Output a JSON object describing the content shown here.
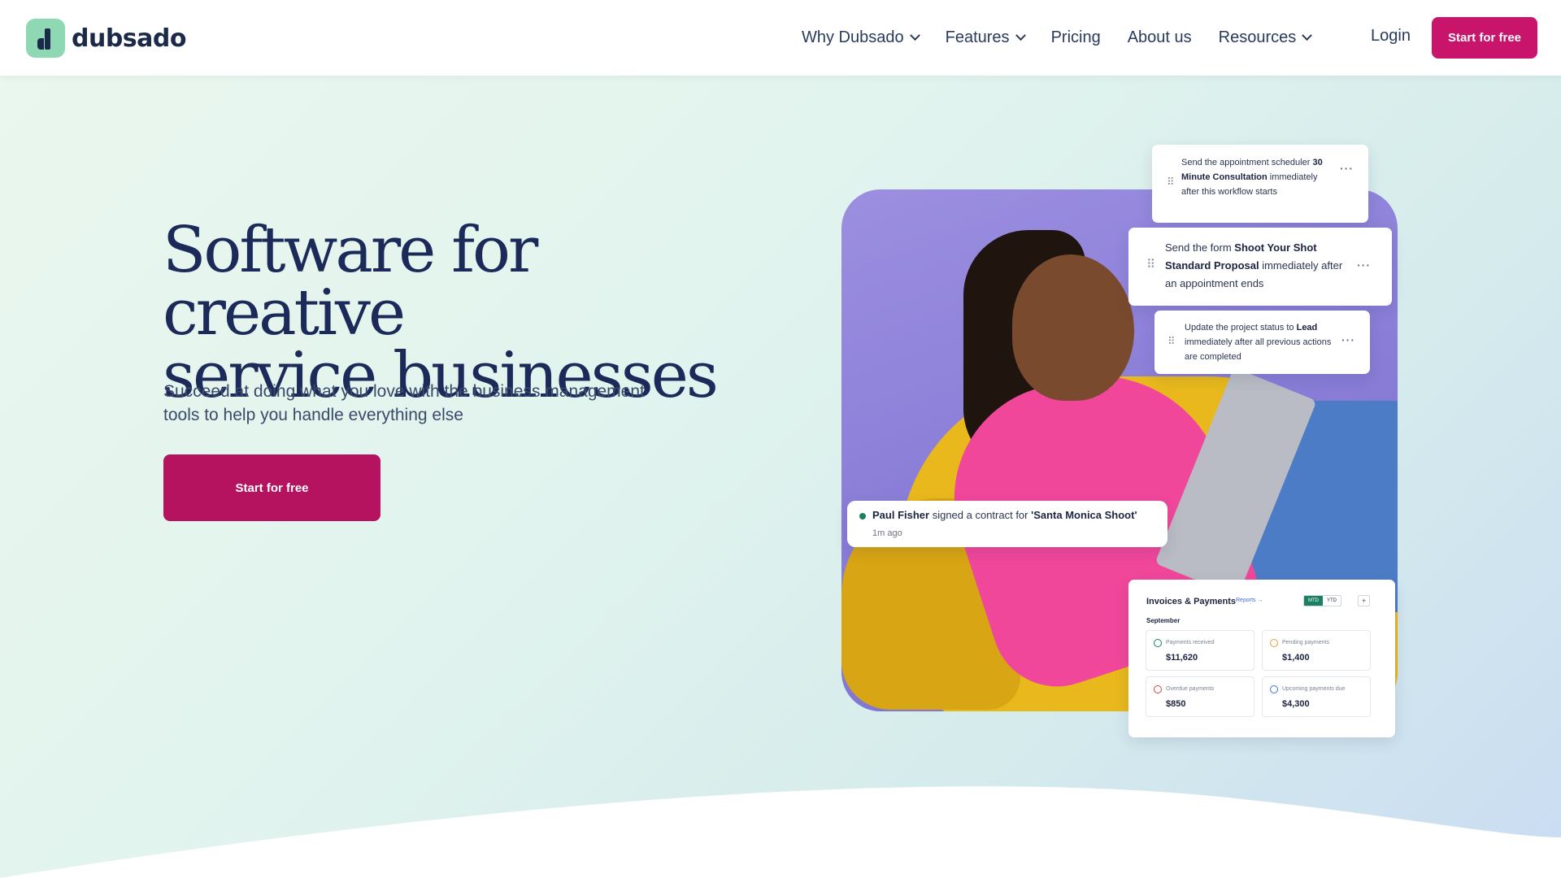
{
  "brand": {
    "name": "dubsado",
    "accent": "#c8146a"
  },
  "nav": {
    "items": [
      {
        "label": "Why Dubsado",
        "has_dropdown": true
      },
      {
        "label": "Features",
        "has_dropdown": true
      },
      {
        "label": "Pricing",
        "has_dropdown": false
      },
      {
        "label": "About us",
        "has_dropdown": false
      },
      {
        "label": "Resources",
        "has_dropdown": true
      }
    ],
    "login": "Login",
    "cta": "Start for free"
  },
  "hero": {
    "title_line1": "Software for creative",
    "title_line2": "service businesses",
    "subtitle": "Succeed at doing what you love with the business management tools to help you handle everything else",
    "cta": "Start for free"
  },
  "workflow": {
    "card1": {
      "pre": "Send the appointment scheduler",
      "bold": "30 Minute Consultation",
      "post": "immediately after this workflow starts"
    },
    "card2": {
      "pre": "Send the form",
      "bold": "Shoot Your Shot Standard Proposal",
      "post": "immediately after an appointment ends"
    },
    "card3": {
      "pre": "Update the project status to",
      "bold": "Lead",
      "post": "immediately after all previous actions are completed"
    }
  },
  "notification": {
    "name": "Paul Fisher",
    "action": "signed a contract for",
    "project": "'Santa Monica Shoot'",
    "time": "1m ago"
  },
  "invoices": {
    "title": "Invoices & Payments",
    "reports_link": "Reports →",
    "toggle": [
      "MTD",
      "YTD"
    ],
    "plus": "+",
    "month": "September",
    "tiles": [
      {
        "label": "Payments received",
        "value": "$11,620",
        "color": "#1b7f62"
      },
      {
        "label": "Pending payments",
        "value": "$1,400",
        "color": "#e0a030"
      },
      {
        "label": "Overdue payments",
        "value": "$850",
        "color": "#d04a3a"
      },
      {
        "label": "Upcoming payments due",
        "value": "$4,300",
        "color": "#3a6fd8"
      }
    ]
  }
}
